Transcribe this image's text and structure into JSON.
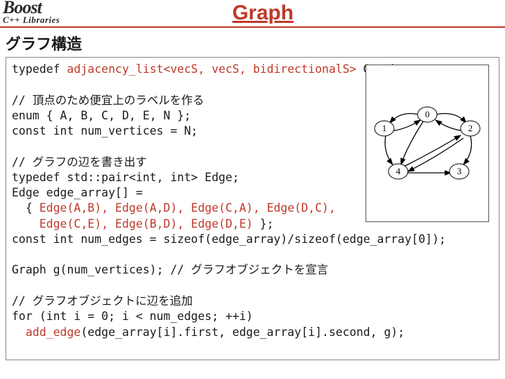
{
  "logo": {
    "top": "Boost",
    "bottom": "C++ Libraries"
  },
  "title": "Graph",
  "subtitle": "グラフ構造",
  "code": {
    "l1a": "typedef ",
    "l1b": "adjacency_list<vecS, vecS, bidirectionalS>",
    "l1c": " Graph;",
    "l2": "",
    "l3": "// 頂点のため便宜上のラベルを作る",
    "l4": "enum { A, B, C, D, E, N };",
    "l5": "const int num_vertices = N;",
    "l6": "",
    "l7": "// グラフの辺を書き出す",
    "l8": "typedef std::pair<int, int> Edge;",
    "l9": "Edge edge_array[] =",
    "l10a": "  { ",
    "l10b": "Edge(A,B), Edge(A,D), Edge(C,A), Edge(D,C),",
    "l11a": "    ",
    "l11b": "Edge(C,E), Edge(B,D), Edge(D,E)",
    "l11c": " };",
    "l12": "const int num_edges = sizeof(edge_array)/sizeof(edge_array[0]);",
    "l13": "",
    "l14": "Graph g(num_vertices); // グラフオブジェクトを宣言",
    "l15": "",
    "l16": "// グラフオブジェクトに辺を追加",
    "l17": "for (int i = 0; i < num_edges; ++i)",
    "l18a": "  ",
    "l18b": "add_edge",
    "l18c": "(edge_array[i].first, edge_array[i].second, g);"
  },
  "graph": {
    "nodes": [
      "0",
      "1",
      "2",
      "3",
      "4"
    ],
    "edges": [
      [
        "0",
        "1"
      ],
      [
        "0",
        "4"
      ],
      [
        "2",
        "0"
      ],
      [
        "4",
        "2"
      ],
      [
        "2",
        "3"
      ],
      [
        "1",
        "4"
      ],
      [
        "4",
        "3"
      ]
    ]
  }
}
